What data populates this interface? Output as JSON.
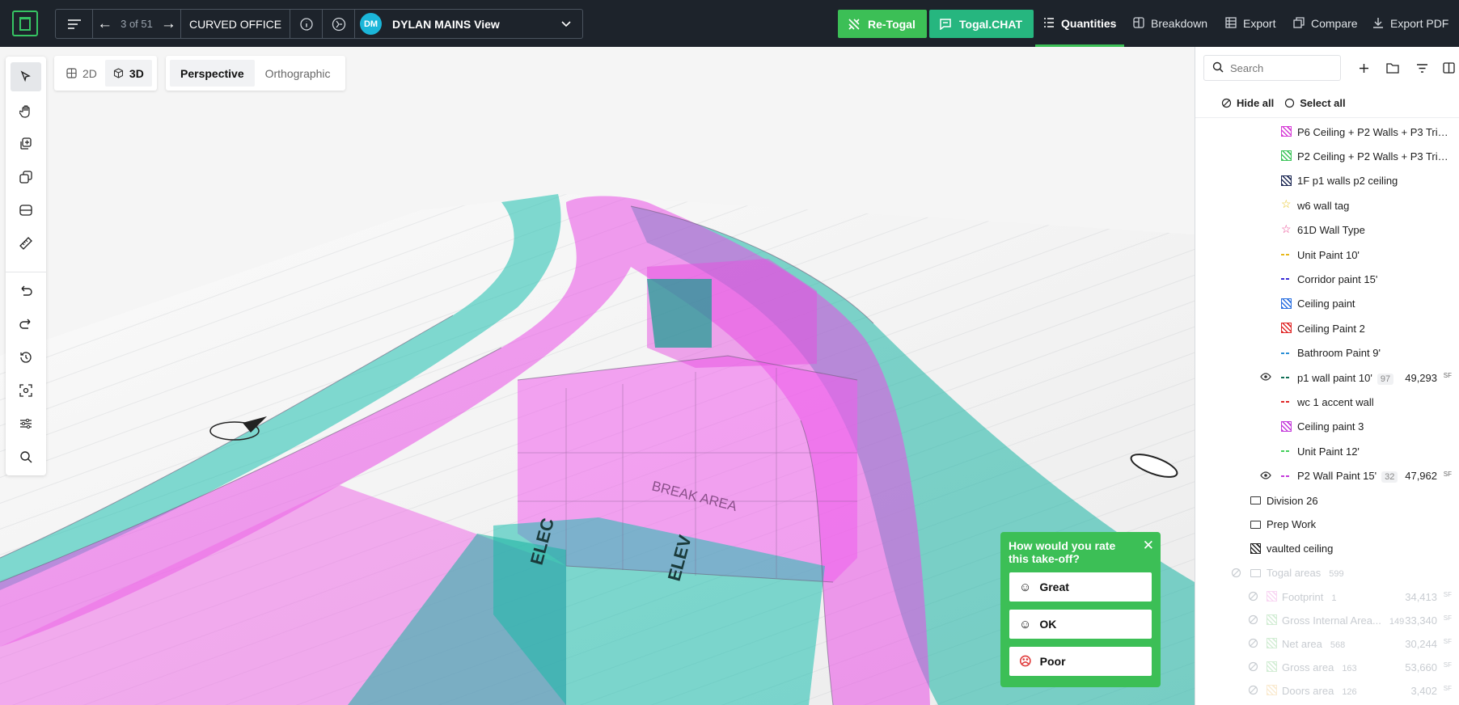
{
  "header": {
    "counter": "3 of 51",
    "project_name": "CURVED OFFICE",
    "avatar_initials": "DM",
    "view_name": "DYLAN MAINS View",
    "retogal_label": "Re-Togal",
    "chat_label": "Togal.CHAT",
    "nav": [
      "Quantities",
      "Breakdown",
      "Export",
      "Compare",
      "Export PDF"
    ],
    "active_nav": "Quantities"
  },
  "view_toggle": {
    "mode_2d": "2D",
    "mode_3d": "3D",
    "active_mode": "3D",
    "perspective": "Perspective",
    "orthographic": "Orthographic",
    "active_projection": "Perspective"
  },
  "toolbar": [
    "select-icon",
    "pan-hand-icon",
    "copy-layers-icon",
    "duplicate-icon",
    "box-select-icon",
    "ruler-icon",
    "undo-icon",
    "redo-icon",
    "history-icon",
    "focus-icon",
    "sliders-icon",
    "search-icon"
  ],
  "panel": {
    "search_placeholder": "Search",
    "hide_all": "Hide all",
    "select_all": "Select all",
    "items": [
      {
        "label": "P6 Ceiling + P2 Walls + P3 Trim...",
        "swatch": "hatch",
        "color": "#d63ad6"
      },
      {
        "label": "P2 Ceiling + P2 Walls + P3 Trim...",
        "swatch": "hatch",
        "color": "#3cc45a"
      },
      {
        "label": "1F p1 walls p2 ceiling",
        "swatch": "hatch",
        "color": "#1e2a55"
      },
      {
        "label": "w6 wall tag",
        "swatch": "star",
        "color": "#e6c21a"
      },
      {
        "label": "61D Wall Type",
        "swatch": "star",
        "color": "#e83e8c"
      },
      {
        "label": "Unit Paint 10'",
        "swatch": "dash",
        "color": "#e8b81a"
      },
      {
        "label": "Corridor paint 15'",
        "swatch": "dash",
        "color": "#3a2bd6"
      },
      {
        "label": "Ceiling paint",
        "swatch": "hatch",
        "color": "#2a6fe0"
      },
      {
        "label": "Ceiling Paint 2",
        "swatch": "hatch",
        "color": "#e02828"
      },
      {
        "label": "Bathroom Paint 9'",
        "swatch": "dash",
        "color": "#2a8fd6"
      },
      {
        "label": "p1 wall paint 10'",
        "swatch": "dash",
        "color": "#0f6e55",
        "count": "97",
        "amount": "49,293",
        "unit": "SF",
        "visible": true
      },
      {
        "label": "wc 1 accent wall",
        "swatch": "dash",
        "color": "#e02828"
      },
      {
        "label": "Ceiling paint 3",
        "swatch": "hatch",
        "color": "#c43adb"
      },
      {
        "label": "Unit Paint 12'",
        "swatch": "dash",
        "color": "#43d05a"
      },
      {
        "label": "P2 Wall Paint 15'",
        "swatch": "dash",
        "color": "#c43adb",
        "count": "32",
        "amount": "47,962",
        "unit": "SF",
        "visible": true
      }
    ],
    "folders": [
      {
        "label": "Division 26",
        "type": "folder"
      },
      {
        "label": "Prep Work",
        "type": "folder"
      },
      {
        "label": "vaulted ceiling",
        "type": "hatch-item"
      }
    ],
    "togal_group": {
      "label": "Togal areas",
      "count": "599",
      "items": [
        {
          "label": "Footprint",
          "count": "1",
          "amount": "34,413",
          "unit": "SF",
          "color": "#f2a7e6"
        },
        {
          "label": "Gross Internal Area...",
          "count": "149",
          "amount": "33,340",
          "unit": "SF",
          "color": "#9ed8a4"
        },
        {
          "label": "Net area",
          "count": "568",
          "amount": "30,244",
          "unit": "SF",
          "color": "#9ed8a4"
        },
        {
          "label": "Gross area",
          "count": "163",
          "amount": "53,660",
          "unit": "SF",
          "color": "#9ed8a4"
        },
        {
          "label": "Doors area",
          "count": "126",
          "amount": "3,402",
          "unit": "SF",
          "color": "#f5d39a"
        }
      ]
    }
  },
  "rating": {
    "question": "How would you rate this take-off?",
    "options": [
      "Great",
      "OK",
      "Poor"
    ]
  },
  "scene_labels": [
    "ELEC",
    "ELEV",
    "BREAK AREA"
  ]
}
